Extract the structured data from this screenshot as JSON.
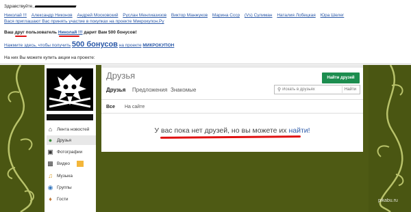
{
  "email": {
    "greeting": "Здравствуйте,",
    "friends": [
      "Николай !!!",
      "Александр Никонов",
      "Андрей Московский",
      "Руслан Менлиазизов",
      "Виктор Манжуков",
      "Марина Ссср",
      "(Vs) Сулиман",
      "Наталия Лобецкая",
      "Юра Шелег"
    ],
    "invite_tail": "Вася приглашают Вас принять участие в покупках на проекте Микрокупон.Ру",
    "gift_prefix": "Ваш друг пользователь",
    "gift_name": "Николай !!!",
    "gift_suffix": "дарит Вам 500 бонусов!",
    "bonus_prefix": "Нажмите здесь, чтобы получить",
    "bonus_big": "500 бонусов",
    "bonus_mid": "на проекте",
    "bonus_project": "МИКРОКУПОН",
    "question": "На них Вы можете купить акции на проекте:"
  },
  "site": {
    "title": "Друзья",
    "find_button": "Найти друзей",
    "tabs": [
      "Друзья",
      "Предложения",
      "Знакомые"
    ],
    "search_placeholder": "Искать в друзьях",
    "search_button": "Найти",
    "subtabs": [
      "Все",
      "На сайте"
    ],
    "empty_message": "У вас пока нет друзей, но вы можете их ",
    "empty_link": "найти!",
    "menu": [
      {
        "icon": "house-icon",
        "label": "Лента новостей"
      },
      {
        "icon": "people-icon",
        "label": "Друзья"
      },
      {
        "icon": "camera-icon",
        "label": "Фотографии"
      },
      {
        "icon": "film-icon",
        "label": "Видео"
      },
      {
        "icon": "music-icon",
        "label": "Музыка"
      },
      {
        "icon": "group-icon",
        "label": "Группы"
      },
      {
        "icon": "guests-icon",
        "label": "Гости"
      }
    ]
  },
  "watermark": "pikabu.ru"
}
